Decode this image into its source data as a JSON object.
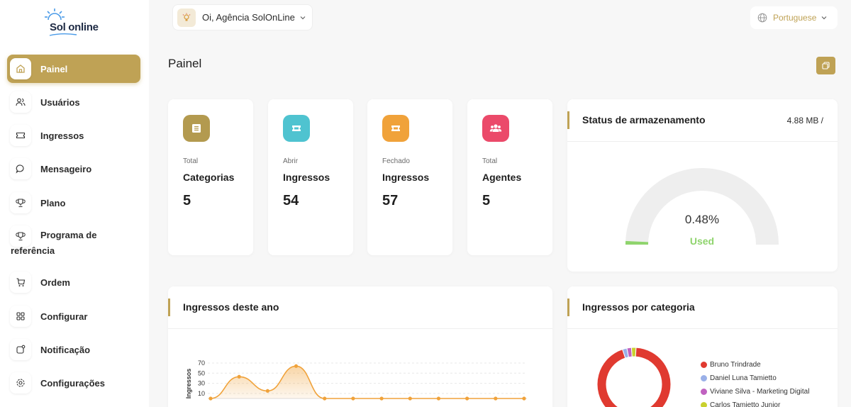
{
  "logo": {
    "text": "Sol online"
  },
  "sidebar": {
    "items": [
      {
        "label": "Painel",
        "icon": "home-icon",
        "active": true
      },
      {
        "label": "Usuários",
        "icon": "users-icon"
      },
      {
        "label": "Ingressos",
        "icon": "ticket-icon"
      },
      {
        "label": "Mensageiro",
        "icon": "chat-icon"
      },
      {
        "label": "Plano",
        "icon": "trophy-icon"
      },
      {
        "label": "Programa de",
        "label2": "referência",
        "icon": "trophy-icon"
      },
      {
        "label": "Ordem",
        "icon": "cart-icon"
      },
      {
        "label": "Configurar",
        "icon": "grid-icon"
      },
      {
        "label": "Notificação",
        "icon": "bell-icon"
      },
      {
        "label": "Configurações",
        "icon": "gear-icon"
      }
    ]
  },
  "header": {
    "greeting": "Oi, Agência SolOnLine",
    "language": "Portuguese"
  },
  "page": {
    "title": "Painel"
  },
  "stats": [
    {
      "sub": "Total",
      "title": "Categorias",
      "value": "5",
      "color": "#b39a4f",
      "icon": "list-icon"
    },
    {
      "sub": "Abrir",
      "title": "Ingressos",
      "value": "54",
      "color": "#4fc3d0",
      "icon": "ticket-icon"
    },
    {
      "sub": "Fechado",
      "title": "Ingressos",
      "value": "57",
      "color": "#f0a23a",
      "icon": "ticket-icon"
    },
    {
      "sub": "Total",
      "title": "Agentes",
      "value": "5",
      "color": "#eb4a6a",
      "icon": "users-icon"
    }
  ],
  "storage": {
    "title": "Status de armazenamento",
    "size": "4.88 MB /",
    "percent": "0.48%",
    "percent_value": 0.48,
    "used_label": "Used",
    "colors": {
      "used": "#8fd46d",
      "track": "#eeeeee"
    }
  },
  "tickets_year": {
    "title": "Ingressos deste ano"
  },
  "tickets_category": {
    "title": "Ingressos por categoria"
  },
  "chart_data": [
    {
      "type": "area",
      "ylabel": "Ingressos",
      "yticks": [
        10,
        30,
        50,
        70
      ],
      "ylim": [
        0,
        70
      ],
      "x": [
        1,
        2,
        3,
        4,
        5,
        6,
        7,
        8,
        9,
        10,
        11,
        12
      ],
      "values": [
        0,
        43,
        15,
        64,
        0,
        0,
        0,
        0,
        0,
        0,
        0,
        0
      ],
      "color": "#f0a23a",
      "grid": true
    },
    {
      "type": "pie",
      "series": [
        {
          "name": "Bruno Trindrade",
          "value": 94,
          "color": "#e03a30"
        },
        {
          "name": "Daniel Luna Tamietto",
          "value": 2,
          "color": "#9ab0e8"
        },
        {
          "name": "Viviane Silva - Marketing Digital",
          "value": 2,
          "color": "#c062c0"
        },
        {
          "name": "Carlos Tamietto Junior",
          "value": 2,
          "color": "#c9d12e"
        }
      ]
    }
  ]
}
